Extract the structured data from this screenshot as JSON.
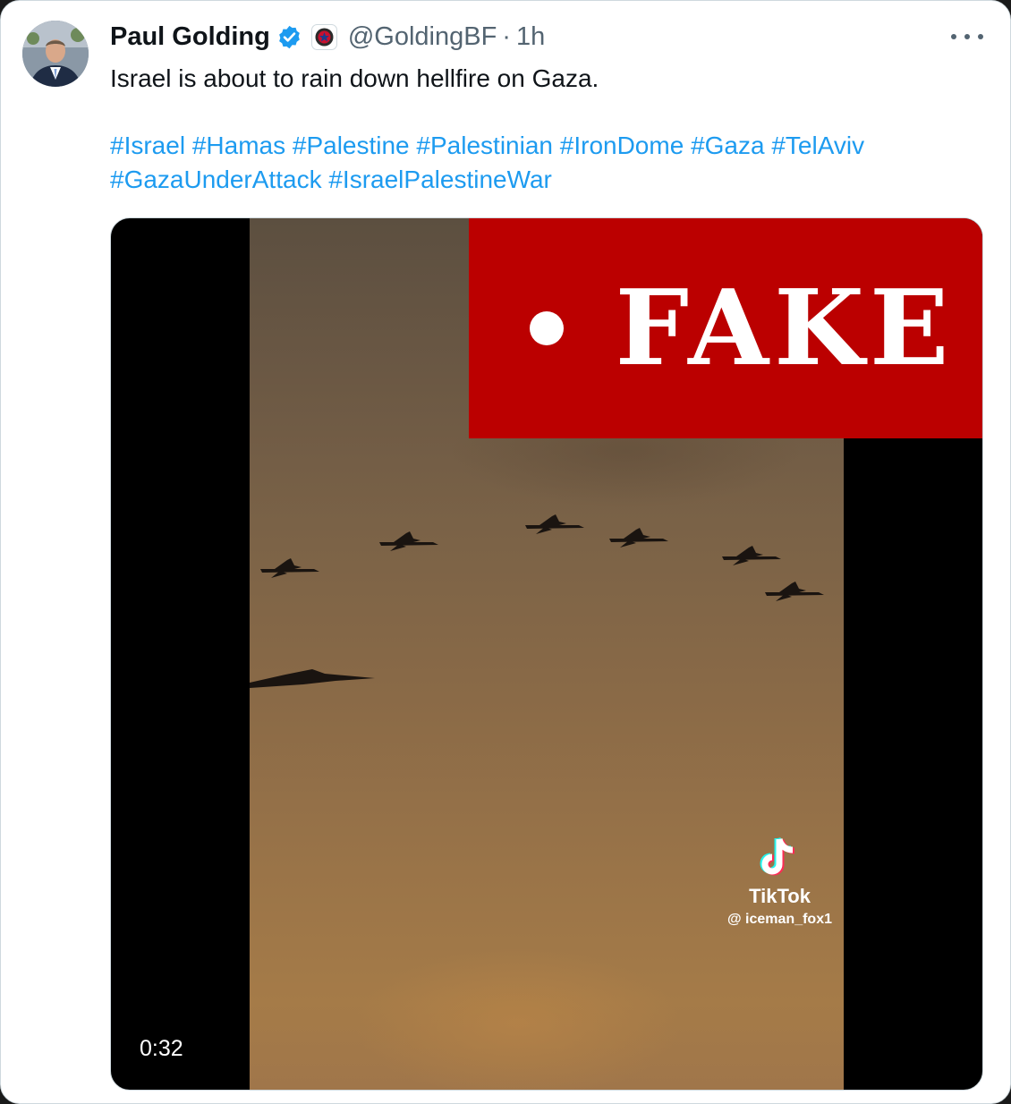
{
  "tweet": {
    "author_name": "Paul Golding",
    "handle": "@GoldingBF",
    "separator": "·",
    "time": "1h",
    "text": "Israel is about to rain down hellfire on Gaza.",
    "hashtags": [
      "#Israel",
      "#Hamas",
      "#Palestine",
      "#Palestinian",
      "#IronDome",
      "#Gaza",
      "#TelAviv",
      "#GazaUnderAttack",
      "#IsraelPalestineWar"
    ],
    "verified": true
  },
  "media": {
    "label": "FAKE",
    "watermark_brand": "TikTok",
    "watermark_user": "@ iceman_fox1",
    "duration": "0:32"
  },
  "icons": [
    "verified-badge-icon",
    "affiliation-badge-icon",
    "more-options-icon",
    "tiktok-logo-icon"
  ],
  "colors": {
    "link": "#1d9bf0",
    "fake_banner": "#bb0000",
    "verified": "#1d9bf0"
  }
}
